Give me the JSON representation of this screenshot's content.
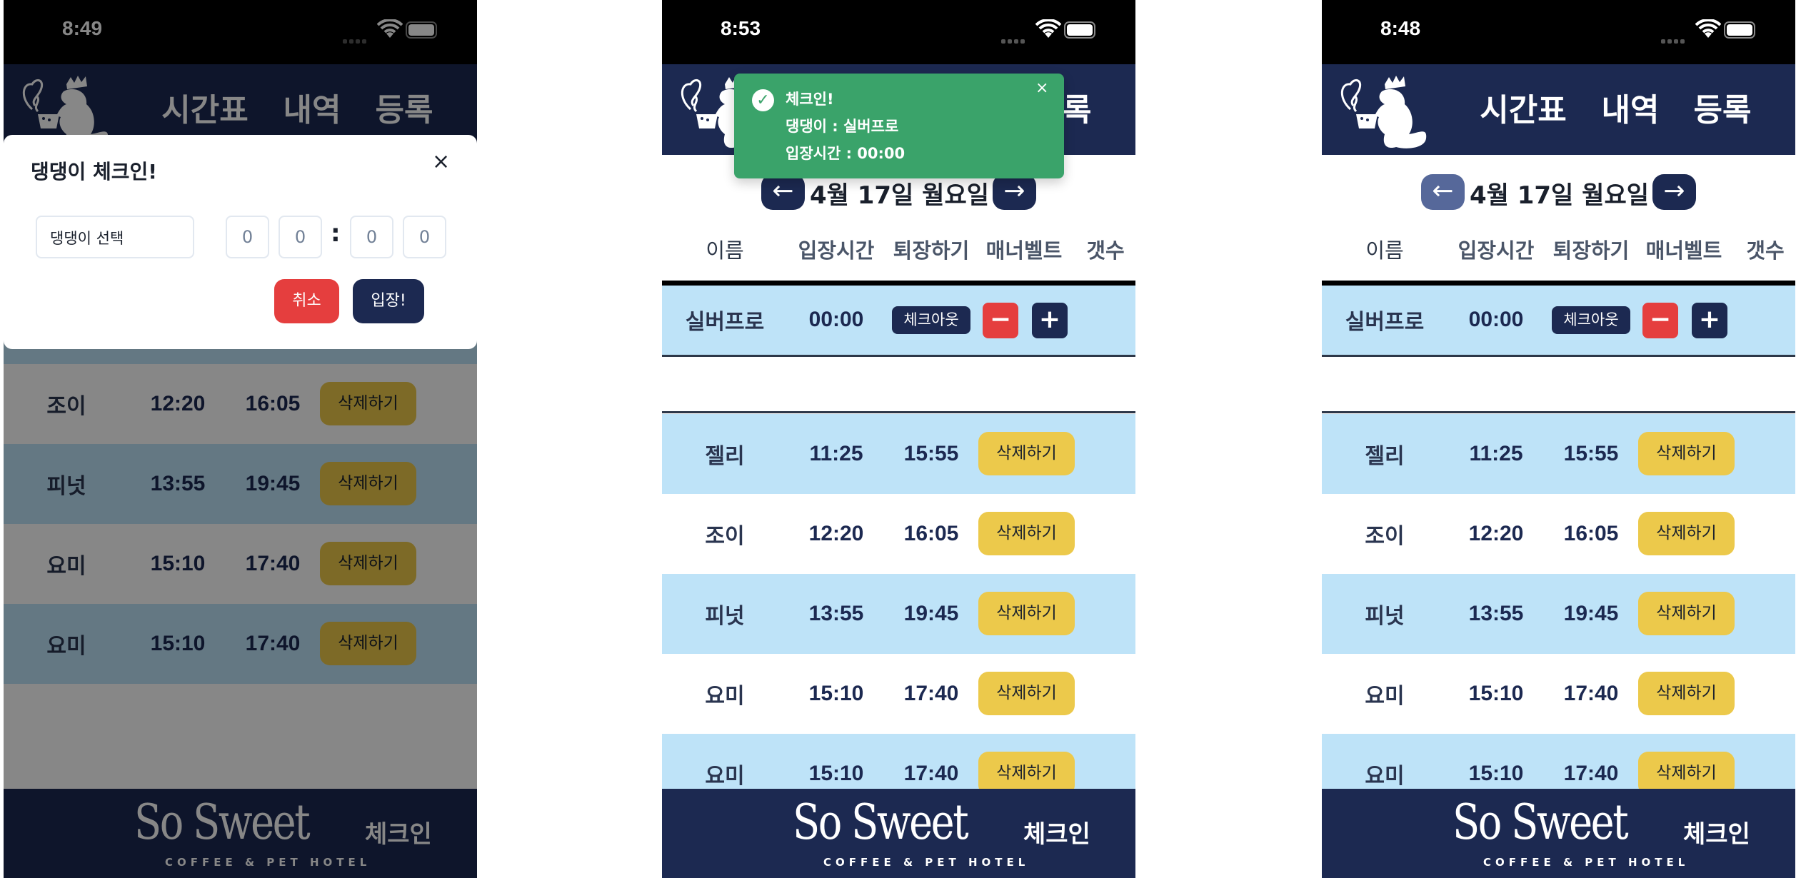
{
  "app": {
    "nav": [
      "시간표",
      "내역",
      "등록"
    ],
    "date": "4월 17일 월요일",
    "prev_icon": "←",
    "next_icon": "→",
    "columns": [
      "이름",
      "입장시간",
      "퇴장하기",
      "매너벨트",
      "갯수"
    ],
    "checked_in": {
      "name": "실버프로",
      "time_in": "00:00",
      "checkout_label": "체크아웃",
      "minus": "−",
      "plus": "+"
    },
    "rows": [
      {
        "name": "젤리",
        "time_in": "11:25",
        "time_out": "15:55",
        "action": "삭제하기"
      },
      {
        "name": "조이",
        "time_in": "12:20",
        "time_out": "16:05",
        "action": "삭제하기"
      },
      {
        "name": "피넛",
        "time_in": "13:55",
        "time_out": "19:45",
        "action": "삭제하기"
      },
      {
        "name": "요미",
        "time_in": "15:10",
        "time_out": "17:40",
        "action": "삭제하기"
      },
      {
        "name": "요미",
        "time_in": "15:10",
        "time_out": "17:40",
        "action": "삭제하기"
      }
    ],
    "footer": {
      "brand": "So Sweet",
      "tagline": "COFFEE & PET HOTEL",
      "label": "체크인"
    },
    "colors": {
      "navy": "#1c2951",
      "row_blue": "#bee3f8",
      "delete_yellow": "#ecc94b",
      "danger_red": "#e53e3e",
      "toast_green": "#3aa36a"
    }
  },
  "phones": [
    {
      "status_time": "8:49",
      "modal": {
        "title": "댕댕이 체크인!",
        "close": "×",
        "select_placeholder": "댕댕이 선택",
        "time_digits": [
          "0",
          "0",
          "0",
          "0"
        ],
        "colon": ":",
        "cancel": "취소",
        "enter": "입장!"
      }
    },
    {
      "status_time": "8:53",
      "toast": {
        "icon": "✓",
        "title": "체크인!",
        "dog_line": "댕댕이 : 실버프로",
        "time_line": "입장시간 : 00:00",
        "close": "×"
      }
    },
    {
      "status_time": "8:48"
    }
  ]
}
